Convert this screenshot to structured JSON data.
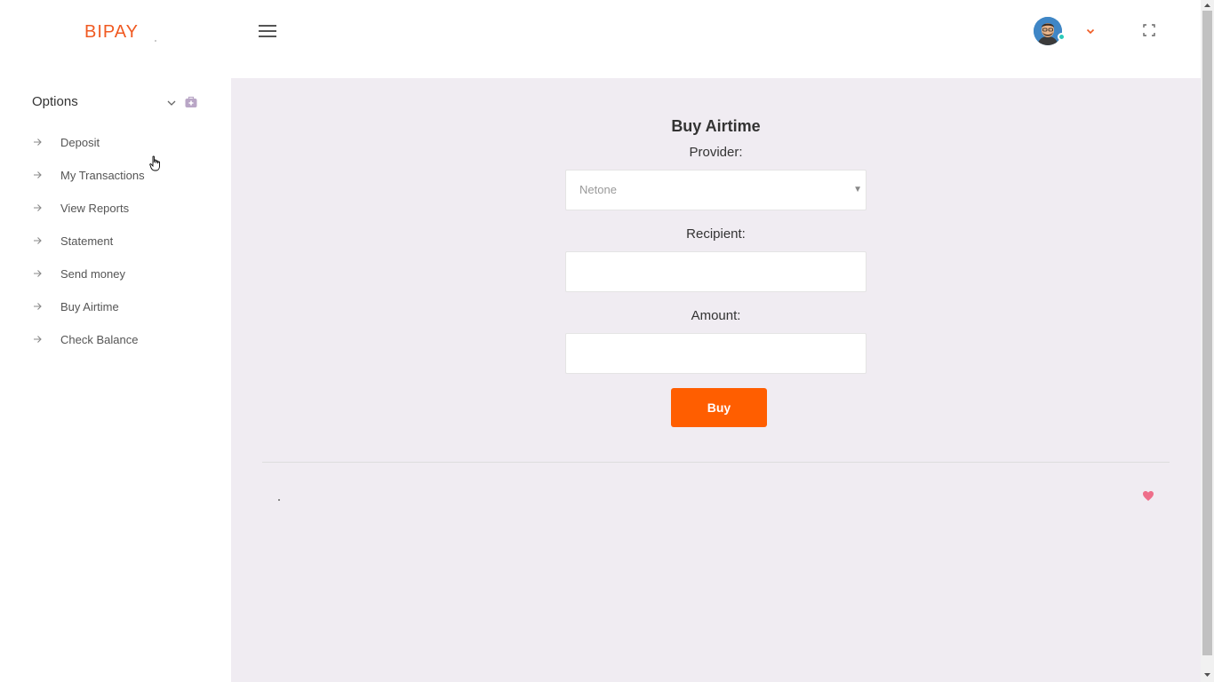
{
  "header": {
    "logo_text": "BIPAY",
    "menu_icon": "hamburger-icon",
    "user_avatar_icon": "avatar",
    "user_menu_icon": "chevron-down-icon",
    "fullscreen_icon": "fullscreen-icon",
    "status_color": "#2bcbba"
  },
  "sidebar": {
    "title": "Options",
    "items": [
      {
        "label": "Deposit"
      },
      {
        "label": "My Transactions"
      },
      {
        "label": "View Reports"
      },
      {
        "label": "Statement"
      },
      {
        "label": "Send money"
      },
      {
        "label": "Buy Airtime"
      },
      {
        "label": "Check Balance"
      }
    ]
  },
  "form": {
    "title": "Buy Airtime",
    "provider_label": "Provider:",
    "provider_value": "Netone",
    "recipient_label": "Recipient:",
    "recipient_value": "",
    "amount_label": "Amount:",
    "amount_value": "",
    "buy_label": "Buy"
  },
  "colors": {
    "brand": "#f05a22",
    "button": "#ff5e00",
    "content_bg": "#f0ecf2",
    "heart": "#ee6e8a"
  }
}
